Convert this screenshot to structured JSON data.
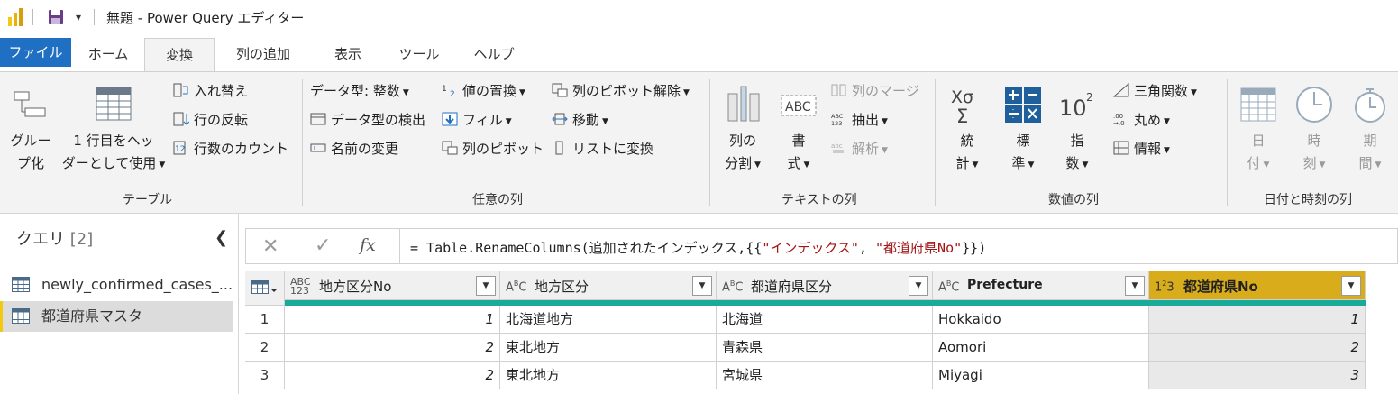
{
  "window": {
    "title": "無題 - Power Query エディター",
    "brand_color": "#f2c811"
  },
  "tabs": [
    {
      "label": "ファイル"
    },
    {
      "label": "ホーム"
    },
    {
      "label": "変換"
    },
    {
      "label": "列の追加"
    },
    {
      "label": "表示"
    },
    {
      "label": "ツール"
    },
    {
      "label": "ヘルプ"
    }
  ],
  "ribbon": {
    "table": {
      "label": "テーブル",
      "group_by": [
        "グルー",
        "プ化"
      ],
      "use_first_row": [
        "1 行目をヘッ",
        "ダーとして使用"
      ],
      "transpose": "入れ替え",
      "reverse_rows": "行の反転",
      "count_rows": "行数のカウント"
    },
    "any_column": {
      "label": "任意の列",
      "data_type": "データ型: 整数",
      "detect_type": "データ型の検出",
      "rename": "名前の変更",
      "replace_values": "値の置換",
      "fill": "フィル",
      "pivot": "列のピボット",
      "unpivot": "列のピボット解除",
      "move": "移動",
      "to_list": "リストに変換"
    },
    "text_column": {
      "label": "テキストの列",
      "split": [
        "列の",
        "分割"
      ],
      "format": [
        "書",
        "式"
      ],
      "merge": "列のマージ",
      "extract": "抽出",
      "parse": "解析"
    },
    "number_column": {
      "label": "数値の列",
      "statistics": [
        "統",
        "計"
      ],
      "standard": [
        "標",
        "準"
      ],
      "scientific": [
        "指",
        "数"
      ],
      "trig": "三角関数",
      "rounding": "丸め",
      "information": "情報"
    },
    "datetime_column": {
      "label": "日付と時刻の列",
      "date": [
        "日",
        "付"
      ],
      "time": [
        "時",
        "刻"
      ],
      "duration": [
        "期",
        "間"
      ]
    }
  },
  "queries": {
    "title": "クエリ",
    "count": "[2]",
    "items": [
      {
        "label": "newly_confirmed_cases_..."
      },
      {
        "label": "都道府県マスタ"
      }
    ]
  },
  "formula": {
    "prefix": "= Table.RenameColumns(追加されたインデックス,{{",
    "str1": "\"インデックス\"",
    "mid": ", ",
    "str2": "\"都道府県No\"",
    "suffix": "}})"
  },
  "grid": {
    "columns": [
      {
        "type": "ABC\n123",
        "name": "地方区分No"
      },
      {
        "type": "ABC",
        "name": "地方区分"
      },
      {
        "type": "ABC",
        "name": "都道府県区分"
      },
      {
        "type": "ABC",
        "name": "Prefecture"
      },
      {
        "type": "123",
        "name": "都道府県No"
      }
    ],
    "rows": [
      {
        "n": "1",
        "c": [
          "1",
          "北海道地方",
          "北海道",
          "Hokkaido",
          "1"
        ]
      },
      {
        "n": "2",
        "c": [
          "2",
          "東北地方",
          "青森県",
          "Aomori",
          "2"
        ]
      },
      {
        "n": "3",
        "c": [
          "2",
          "東北地方",
          "宮城県",
          "Miyagi",
          "3"
        ]
      }
    ],
    "quality_color": "#1aaa99",
    "selected_header_color": "#d8ac1a"
  }
}
